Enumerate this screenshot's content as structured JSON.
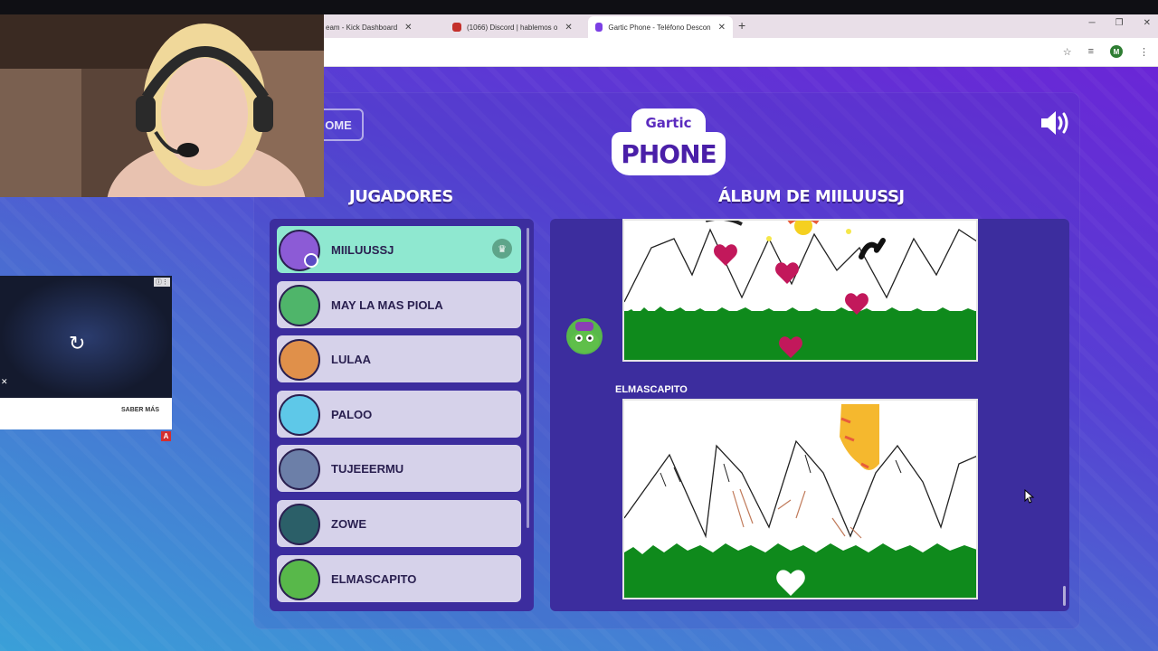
{
  "browser": {
    "tabs": [
      {
        "title": "eam - Kick Dashboard",
        "active": false,
        "icon_color": "#e9dfe8"
      },
      {
        "title": "(1066) Discord | hablemos o",
        "active": false,
        "icon_color": "#c4302b"
      },
      {
        "title": "Gartic Phone - Teléfono Descon",
        "active": true,
        "icon_color": "#7b3fe4"
      }
    ],
    "new_tab_glyph": "+",
    "profile_initial": "M"
  },
  "game": {
    "home_label": "OME",
    "logo_top": "Gartic",
    "logo_bottom": "PHONE",
    "players_heading": "JUGADORES",
    "album_heading": "ÁLBUM DE MIILUUSSJ",
    "players": [
      {
        "name": "MIILUUSSJ",
        "host": true,
        "avatar_color": "#8c5bd6"
      },
      {
        "name": "MAY LA MAS PIOLA",
        "host": false,
        "avatar_color": "#4fb56a"
      },
      {
        "name": "LULAA",
        "host": false,
        "avatar_color": "#e0904a"
      },
      {
        "name": "PALOO",
        "host": false,
        "avatar_color": "#5ec8e8"
      },
      {
        "name": "TUJEEERMU",
        "host": false,
        "avatar_color": "#6c7fa8"
      },
      {
        "name": "ZOWE",
        "host": false,
        "avatar_color": "#2b5f68"
      },
      {
        "name": "ELMASCAPITO",
        "host": false,
        "avatar_color": "#58b84a"
      }
    ],
    "album_entry_author": "ELMASCAPITO"
  },
  "ad": {
    "cta": "SABER MÁS",
    "badge": "A"
  },
  "icons": {
    "sound": "speaker-icon",
    "crown": "crown-icon",
    "replay": "replay-icon"
  }
}
